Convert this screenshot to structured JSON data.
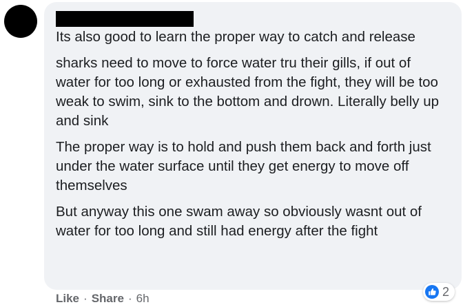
{
  "comment": {
    "paragraphs": [
      "Its also good to learn the proper way to catch and release",
      "sharks need to move to force water tru their gills, if out of water for too long or exhausted from the fight, they will be too weak to swim, sink to the bottom and drown. Literally belly up and sink",
      "The proper way is to hold and push them back and forth just under the water surface until they get energy to move off themselves",
      "But anyway this one swam away so obviously wasnt out of water for too long and still had energy after the fight"
    ],
    "reactions": {
      "icon": "thumbs-up-icon",
      "count": "2",
      "color": "#1877f2"
    },
    "actions": {
      "like_label": "Like",
      "share_label": "Share",
      "separator": "·",
      "timestamp": "6h"
    }
  },
  "colors": {
    "bubble": "#f0f2f5",
    "text": "#1c1e21",
    "secondary_text": "#65676b",
    "redaction": "#000000"
  }
}
